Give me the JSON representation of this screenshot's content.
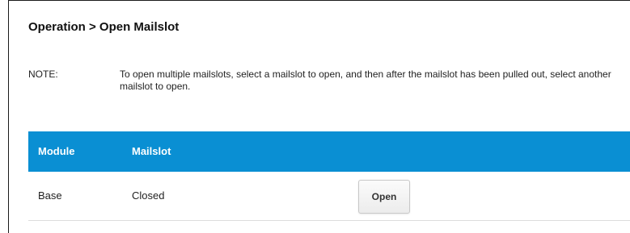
{
  "page": {
    "title": "Operation > Open Mailslot"
  },
  "note": {
    "label": "NOTE:",
    "text": "To open multiple mailslots, select a mailslot to open, and then after the mailslot has been pulled out, select another mailslot to open."
  },
  "table": {
    "headers": {
      "module": "Module",
      "mailslot": "Mailslot"
    },
    "rows": [
      {
        "module": "Base",
        "status": "Closed",
        "action_label": "Open"
      }
    ]
  },
  "colors": {
    "header_bg": "#0a8fd3",
    "header_text": "#ffffff"
  }
}
